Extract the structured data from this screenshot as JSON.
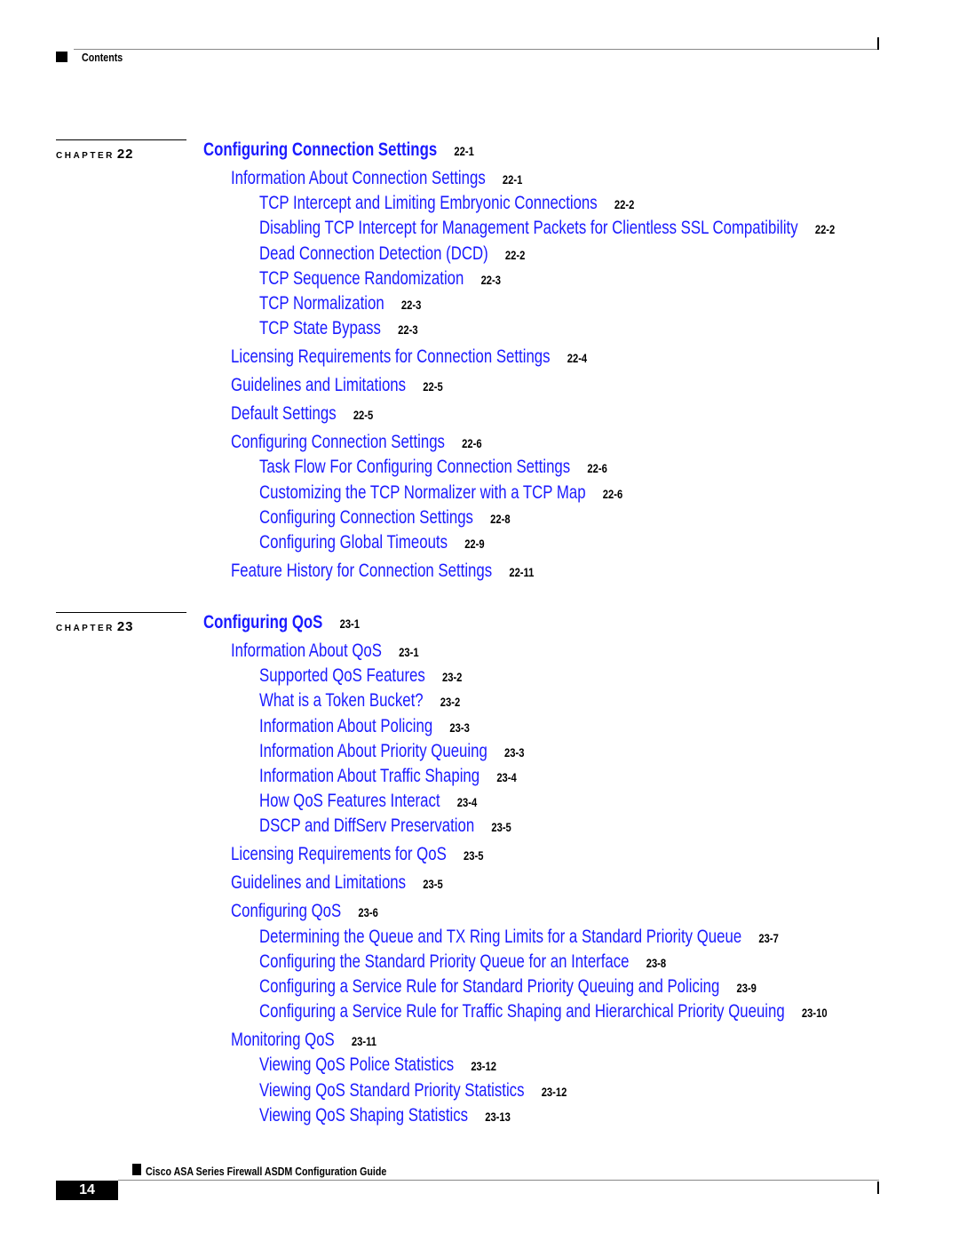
{
  "header": {
    "label": "Contents"
  },
  "footer": {
    "title": "Cisco ASA Series Firewall ASDM Configuration Guide",
    "page_number": "14"
  },
  "chapters": [
    {
      "chapter_word": "CHAPTER",
      "number": "22",
      "title": "Configuring Connection Settings",
      "page": "22-1",
      "entries": [
        {
          "level": 1,
          "title": "Information About Connection Settings",
          "page": "22-1"
        },
        {
          "level": 2,
          "title": "TCP Intercept and Limiting Embryonic Connections",
          "page": "22-2"
        },
        {
          "level": 2,
          "title": "Disabling TCP Intercept for Management Packets for Clientless SSL Compatibility",
          "page": "22-2"
        },
        {
          "level": 2,
          "title": "Dead Connection Detection (DCD)",
          "page": "22-2"
        },
        {
          "level": 2,
          "title": "TCP Sequence Randomization",
          "page": "22-3"
        },
        {
          "level": 2,
          "title": "TCP Normalization",
          "page": "22-3"
        },
        {
          "level": 2,
          "title": "TCP State Bypass",
          "page": "22-3"
        },
        {
          "level": 1,
          "title": "Licensing Requirements for Connection Settings",
          "page": "22-4"
        },
        {
          "level": 1,
          "title": "Guidelines and Limitations",
          "page": "22-5"
        },
        {
          "level": 1,
          "title": "Default Settings",
          "page": "22-5"
        },
        {
          "level": 1,
          "title": "Configuring Connection Settings",
          "page": "22-6"
        },
        {
          "level": 2,
          "title": "Task Flow For Configuring Connection Settings",
          "page": "22-6"
        },
        {
          "level": 2,
          "title": "Customizing the TCP Normalizer with a TCP Map",
          "page": "22-6"
        },
        {
          "level": 2,
          "title": "Configuring Connection Settings",
          "page": "22-8"
        },
        {
          "level": 2,
          "title": "Configuring Global Timeouts",
          "page": "22-9"
        },
        {
          "level": 1,
          "title": "Feature History for Connection Settings",
          "page": "22-11"
        }
      ]
    },
    {
      "chapter_word": "CHAPTER",
      "number": "23",
      "title": "Configuring QoS",
      "page": "23-1",
      "entries": [
        {
          "level": 1,
          "title": "Information About QoS",
          "page": "23-1"
        },
        {
          "level": 2,
          "title": "Supported QoS Features",
          "page": "23-2"
        },
        {
          "level": 2,
          "title": "What is a Token Bucket?",
          "page": "23-2"
        },
        {
          "level": 2,
          "title": "Information About Policing",
          "page": "23-3"
        },
        {
          "level": 2,
          "title": "Information About Priority Queuing",
          "page": "23-3"
        },
        {
          "level": 2,
          "title": "Information About Traffic Shaping",
          "page": "23-4"
        },
        {
          "level": 2,
          "title": "How QoS Features Interact",
          "page": "23-4"
        },
        {
          "level": 2,
          "title": "DSCP and DiffServ Preservation",
          "page": "23-5"
        },
        {
          "level": 1,
          "title": "Licensing Requirements for QoS",
          "page": "23-5"
        },
        {
          "level": 1,
          "title": "Guidelines and Limitations",
          "page": "23-5"
        },
        {
          "level": 1,
          "title": "Configuring QoS",
          "page": "23-6"
        },
        {
          "level": 2,
          "title": "Determining the Queue and TX Ring Limits for a Standard Priority Queue",
          "page": "23-7"
        },
        {
          "level": 2,
          "title": "Configuring the Standard Priority Queue for an Interface",
          "page": "23-8"
        },
        {
          "level": 2,
          "title": "Configuring a Service Rule for Standard Priority Queuing and Policing",
          "page": "23-9"
        },
        {
          "level": 2,
          "title": "Configuring a Service Rule for Traffic Shaping and Hierarchical Priority Queuing",
          "page": "23-10"
        },
        {
          "level": 1,
          "title": "Monitoring QoS",
          "page": "23-11"
        },
        {
          "level": 2,
          "title": "Viewing QoS Police Statistics",
          "page": "23-12"
        },
        {
          "level": 2,
          "title": "Viewing QoS Standard Priority Statistics",
          "page": "23-12"
        },
        {
          "level": 2,
          "title": "Viewing QoS Shaping Statistics",
          "page": "23-13"
        }
      ]
    }
  ]
}
